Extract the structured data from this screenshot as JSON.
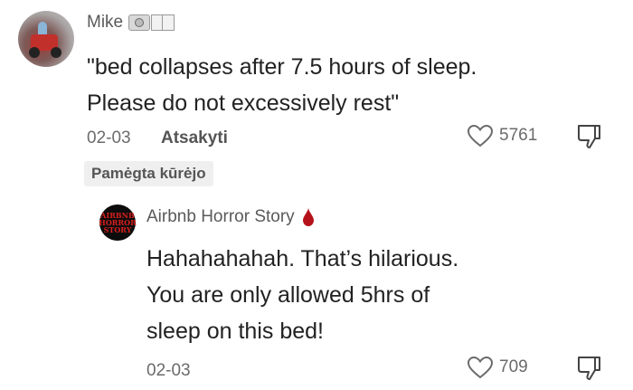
{
  "comment": {
    "username": "Mike",
    "text_line1": "\"bed collapses after 7.5 hours of sleep.",
    "text_line2": "Please do not excessively rest\"",
    "date": "02-03",
    "reply_label": "Atsakyti",
    "like_count": "5761",
    "creator_badge": "Pamėgta kūrėjo"
  },
  "reply": {
    "avatar_text": [
      "AIRBNB",
      "HORROR",
      "STORY"
    ],
    "username": "Airbnb Horror Story",
    "text_line1": "Hahahahahah. That’s hilarious.",
    "text_line2": "You are only allowed 5hrs of",
    "text_line3": "sleep on this bed!",
    "date": "02-03",
    "like_count": "709"
  },
  "icons": {
    "heart": "heart-icon",
    "dislike": "thumbs-down-icon",
    "camera": "camera-icon",
    "book": "book-icon",
    "blood_drop": "blood-drop-icon"
  },
  "colors": {
    "text": "#222222",
    "meta": "#6b6b6b",
    "blood": "#b5121b"
  }
}
